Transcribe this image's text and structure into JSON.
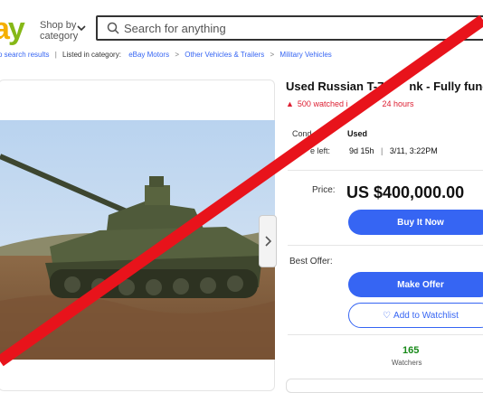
{
  "header": {
    "shop_by": "Shop by",
    "category": "category",
    "search_placeholder": "Search for anything"
  },
  "breadcrumb": {
    "back": "o search results",
    "listed_in": "Listed in category:",
    "items": [
      "eBay Motors",
      "Other Vehicles & Trailers",
      "Military Vehicles"
    ]
  },
  "listing": {
    "title": "Used Russian T-7",
    "title_tail": "nk - Fully funct",
    "watched": "500 watched i",
    "watched_tail": "24 hours",
    "condition_label": "Cond",
    "condition_value": "Used",
    "time_label": "e left:",
    "time_value": "9d 15h",
    "time_end": "3/11, 3:22PM",
    "price_label": "Price:",
    "price": "US $400,000.00",
    "buy_now": "Buy It Now",
    "best_offer_label": "Best Offer:",
    "make_offer": "Make Offer",
    "add_watchlist": "Add to Watchlist",
    "watchers_count": "165",
    "watchers_label": "Watchers"
  },
  "colors": {
    "accent": "#3665f3",
    "alert": "#dd1e31",
    "cross": "#e8131b"
  }
}
